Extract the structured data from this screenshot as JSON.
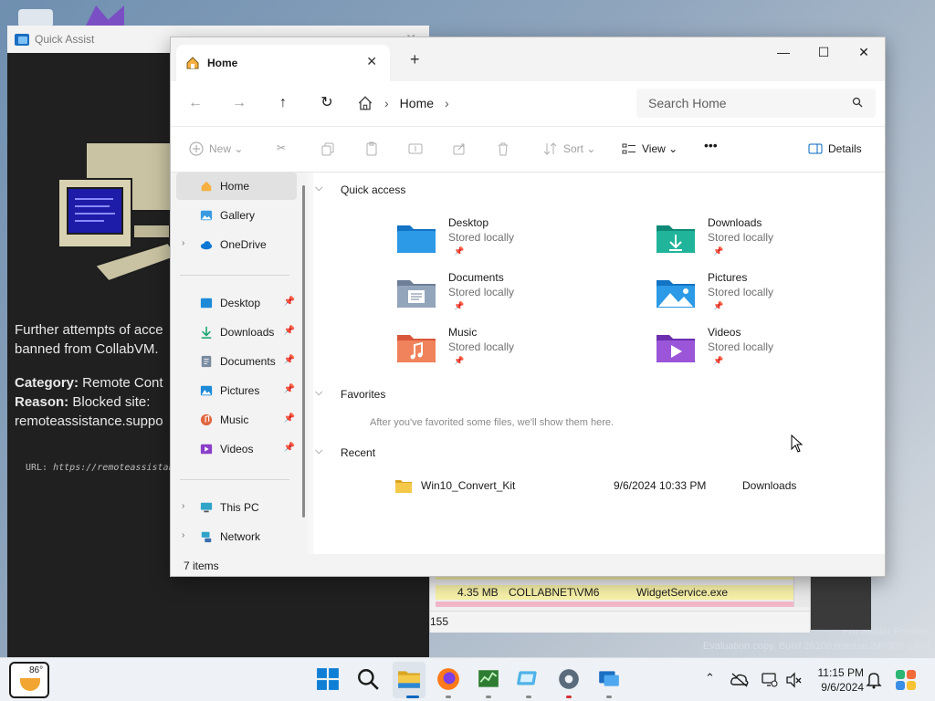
{
  "quick_assist": {
    "title": "Quick Assist",
    "line1": "Further attempts of acce",
    "line2": "banned from CollabVM.",
    "category_label": "Category:",
    "category_value": " Remote Cont",
    "reason_label": "Reason:",
    "reason_value": " Blocked site:",
    "site": "remoteassistance.suppo",
    "url_label": "URL: ",
    "url_value": "https://remoteassistanc",
    "bottom_count": "155"
  },
  "task_manager": {
    "rows": [
      {
        "size": "4.35 MB",
        "user": "COLLABNET\\VM6",
        "name": "WidgetService.exe"
      }
    ]
  },
  "watermark": {
    "line1": "Pro Insider Preview",
    "line2": "Evaluation copy. Build 26100.release.240308-1400"
  },
  "explorer": {
    "tab_title": "Home",
    "breadcrumb": "Home",
    "search_placeholder": "Search Home",
    "commands": {
      "new": "New",
      "sort": "Sort",
      "view": "View",
      "more": "•••",
      "details": "Details"
    },
    "sidebar": {
      "home": "Home",
      "gallery": "Gallery",
      "onedrive": "OneDrive",
      "desktop": "Desktop",
      "downloads": "Downloads",
      "documents": "Documents",
      "pictures": "Pictures",
      "music": "Music",
      "videos": "Videos",
      "this_pc": "This PC",
      "network": "Network"
    },
    "sections": {
      "quick_access": "Quick access",
      "favorites": "Favorites",
      "recent": "Recent",
      "favorites_hint": "After you've favorited some files, we'll show them here."
    },
    "quick_access_items": [
      {
        "name": "Desktop",
        "sub": "Stored locally"
      },
      {
        "name": "Downloads",
        "sub": "Stored locally"
      },
      {
        "name": "Documents",
        "sub": "Stored locally"
      },
      {
        "name": "Pictures",
        "sub": "Stored locally"
      },
      {
        "name": "Music",
        "sub": "Stored locally"
      },
      {
        "name": "Videos",
        "sub": "Stored locally"
      }
    ],
    "recent_items": [
      {
        "name": "Win10_Convert_Kit",
        "date": "9/6/2024 10:33 PM",
        "location": "Downloads"
      }
    ],
    "status": "7 items"
  },
  "taskbar": {
    "weather_temp": "86°",
    "time": "11:15 PM",
    "date": "9/6/2024"
  },
  "colors": {
    "accent": "#0067c0",
    "folder_yellow": "#f4c94a",
    "qa_bg": "#202020"
  }
}
